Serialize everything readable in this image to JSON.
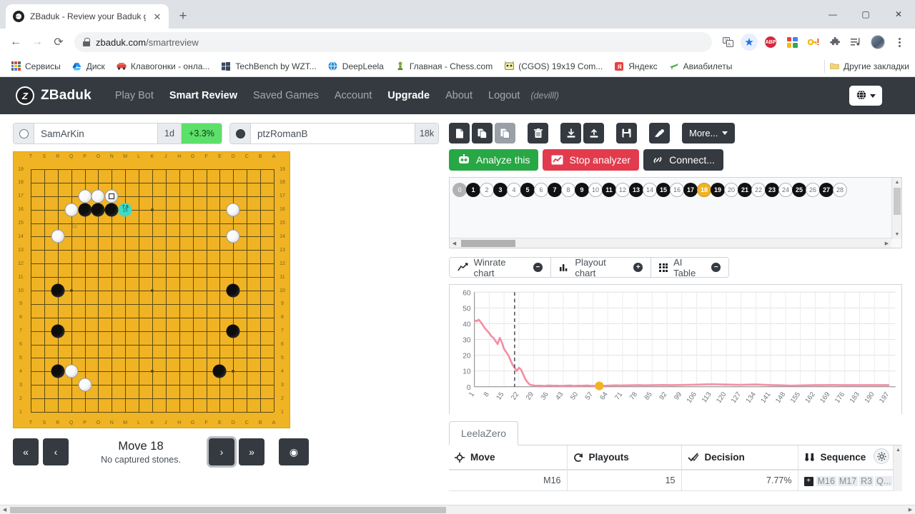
{
  "browser": {
    "tab": {
      "title": "ZBaduk - Review your Baduk gam",
      "favicon": "zbaduk-favicon",
      "close_label": "✕"
    },
    "newtab_label": "+",
    "window_controls": {
      "minimize": "—",
      "maximize": "▢",
      "close": "✕"
    },
    "nav": {
      "back": "←",
      "forward": "→",
      "reload": "⟳"
    },
    "omnibox": {
      "host": "zbaduk.com",
      "path": "/smartreview",
      "lock": "lock-icon"
    },
    "toolbar_icons": [
      {
        "name": "translate-icon",
        "glyph": "🗐"
      },
      {
        "name": "bookmark-star-icon",
        "glyph": "★"
      },
      {
        "name": "adblock-plus-icon",
        "glyph": "ABP"
      },
      {
        "name": "color-grid-icon",
        "glyph": ""
      },
      {
        "name": "password-key-icon",
        "glyph": "🔑"
      },
      {
        "name": "extensions-puzzle-icon",
        "glyph": "🧩"
      },
      {
        "name": "media-playlist-icon",
        "glyph": "≡♪"
      },
      {
        "name": "profile-avatar",
        "glyph": ""
      },
      {
        "name": "chrome-menu-icon",
        "glyph": "⋮"
      }
    ],
    "bookmarks": [
      {
        "label": "Сервисы",
        "icon": "apps-grid-icon"
      },
      {
        "label": "Диск",
        "icon": "drive-icon"
      },
      {
        "label": "Клавогонки - онла...",
        "icon": "car-icon"
      },
      {
        "label": "TechBench by WZT...",
        "icon": "windows-icon"
      },
      {
        "label": "DeepLeela",
        "icon": "globe-icon"
      },
      {
        "label": "Главная - Chess.com",
        "icon": "pawn-icon"
      },
      {
        "label": "(CGOS) 19x19 Com...",
        "icon": "cgos-icon"
      },
      {
        "label": "Яндекс",
        "icon": "yandex-icon"
      },
      {
        "label": "Авиабилеты",
        "icon": "plane-icon"
      }
    ],
    "other_bookmarks": {
      "label": "Другие закладки",
      "icon": "folder-icon"
    }
  },
  "site": {
    "brand": {
      "text": "ZBaduk",
      "logo_letter": "Z"
    },
    "nav_items": [
      {
        "label": "Play Bot",
        "state": "normal"
      },
      {
        "label": "Smart Review",
        "state": "active"
      },
      {
        "label": "Saved Games",
        "state": "normal"
      },
      {
        "label": "Account",
        "state": "normal"
      },
      {
        "label": "Upgrade",
        "state": "strong"
      },
      {
        "label": "About",
        "state": "normal"
      },
      {
        "label": "Logout",
        "state": "normal"
      }
    ],
    "user": "(devilll)",
    "language_button": {
      "icon": "globe-icon",
      "caret": "▾"
    }
  },
  "players": {
    "white": {
      "name": "SamArKin",
      "rank": "1d",
      "delta": "+3.3%",
      "stone": "white-stone",
      "delta_color": "#5ce06a"
    },
    "black": {
      "name": "ptzRomanB",
      "rank": "18k",
      "stone": "black-stone"
    }
  },
  "board": {
    "size": 19,
    "col_labels": [
      "T",
      "S",
      "R",
      "Q",
      "P",
      "O",
      "N",
      "M",
      "L",
      "K",
      "J",
      "H",
      "G",
      "F",
      "E",
      "D",
      "C",
      "B",
      "A"
    ],
    "row_labels": [
      "19",
      "18",
      "17",
      "16",
      "15",
      "14",
      "13",
      "12",
      "11",
      "10",
      "9",
      "8",
      "7",
      "6",
      "5",
      "4",
      "3",
      "2",
      "1"
    ],
    "stones": [
      {
        "col": 4,
        "row": 2,
        "color": "white"
      },
      {
        "col": 5,
        "row": 2,
        "color": "white"
      },
      {
        "col": 6,
        "row": 2,
        "color": "white",
        "last": true
      },
      {
        "col": 3,
        "row": 3,
        "color": "white"
      },
      {
        "col": 4,
        "row": 3,
        "color": "black"
      },
      {
        "col": 5,
        "row": 3,
        "color": "black"
      },
      {
        "col": 6,
        "row": 3,
        "color": "black"
      },
      {
        "col": 15,
        "row": 3,
        "color": "white"
      },
      {
        "col": 2,
        "row": 5,
        "color": "white"
      },
      {
        "col": 15,
        "row": 5,
        "color": "white"
      },
      {
        "col": 2,
        "row": 9,
        "color": "black"
      },
      {
        "col": 15,
        "row": 9,
        "color": "black"
      },
      {
        "col": 2,
        "row": 12,
        "color": "black"
      },
      {
        "col": 15,
        "row": 12,
        "color": "black"
      },
      {
        "col": 2,
        "row": 15,
        "color": "black"
      },
      {
        "col": 3,
        "row": 15,
        "color": "white"
      },
      {
        "col": 14,
        "row": 15,
        "color": "black"
      },
      {
        "col": 4,
        "row": 16,
        "color": "white"
      }
    ],
    "suggestion": {
      "col": 7,
      "row": 3,
      "top": "7.8",
      "bottom": "15",
      "color": "#3ddbc8"
    },
    "ghost": {
      "col": 3,
      "row": 4,
      "label": "14"
    }
  },
  "board_controls": {
    "first": "«",
    "prev": "‹",
    "next": "›",
    "last": "»",
    "eye": "◉",
    "move_title": "Move 18",
    "move_sub": "No captured stones."
  },
  "toolbar": {
    "buttons": [
      {
        "name": "new-file-button",
        "glyph": "🗋"
      },
      {
        "name": "copy-button",
        "glyph": "🗎"
      },
      {
        "name": "paste-button",
        "glyph": "🗐",
        "state": "lit"
      },
      {
        "name": "delete-button",
        "glyph": "🗑"
      },
      {
        "name": "download-button",
        "glyph": "⤓"
      },
      {
        "name": "upload-button",
        "glyph": "⤒"
      },
      {
        "name": "save-button",
        "glyph": "🖫"
      },
      {
        "name": "edit-button",
        "glyph": "✎"
      }
    ],
    "more_label": "More...",
    "more_caret": "▾"
  },
  "actions": {
    "analyze": {
      "label": "Analyze this",
      "icon": "robot-icon",
      "color": "#28a745"
    },
    "stop": {
      "label": "Stop analyzer",
      "icon": "chart-icon",
      "color": "#e23b4d"
    },
    "connect": {
      "label": "Connect...",
      "icon": "link-icon",
      "color": "#343a40"
    }
  },
  "move_list": {
    "moves": [
      {
        "n": "0",
        "type": "zero"
      },
      {
        "n": "1",
        "type": "b"
      },
      {
        "n": "2",
        "type": "w"
      },
      {
        "n": "3",
        "type": "b"
      },
      {
        "n": "4",
        "type": "w"
      },
      {
        "n": "5",
        "type": "b"
      },
      {
        "n": "6",
        "type": "w"
      },
      {
        "n": "7",
        "type": "b"
      },
      {
        "n": "8",
        "type": "w"
      },
      {
        "n": "9",
        "type": "b"
      },
      {
        "n": "10",
        "type": "w"
      },
      {
        "n": "11",
        "type": "b"
      },
      {
        "n": "12",
        "type": "w"
      },
      {
        "n": "13",
        "type": "b"
      },
      {
        "n": "14",
        "type": "w"
      },
      {
        "n": "15",
        "type": "b"
      },
      {
        "n": "16",
        "type": "w"
      },
      {
        "n": "17",
        "type": "b"
      },
      {
        "n": "18",
        "type": "cur"
      },
      {
        "n": "19",
        "type": "b"
      },
      {
        "n": "20",
        "type": "w"
      },
      {
        "n": "21",
        "type": "b"
      },
      {
        "n": "22",
        "type": "w"
      },
      {
        "n": "23",
        "type": "b"
      },
      {
        "n": "24",
        "type": "w"
      },
      {
        "n": "25",
        "type": "b"
      },
      {
        "n": "26",
        "type": "w"
      },
      {
        "n": "27",
        "type": "b"
      },
      {
        "n": "28",
        "type": "w"
      }
    ]
  },
  "chart_tabs": [
    {
      "label": "Winrate chart",
      "icon": "line-chart-icon",
      "toggle": "−"
    },
    {
      "label": "Playout chart",
      "icon": "bar-chart-icon",
      "toggle": "+"
    },
    {
      "label": "AI Table",
      "icon": "grid-icon",
      "toggle": "−"
    }
  ],
  "chart_data": {
    "type": "line",
    "title": "",
    "xlabel": "",
    "ylabel": "",
    "ylim": [
      0,
      60
    ],
    "yticks": [
      0,
      10,
      20,
      30,
      40,
      50,
      60
    ],
    "xlim": [
      1,
      200
    ],
    "xticks": [
      1,
      8,
      15,
      22,
      29,
      36,
      43,
      50,
      57,
      64,
      71,
      78,
      85,
      92,
      99,
      106,
      113,
      120,
      127,
      134,
      141,
      148,
      155,
      162,
      169,
      176,
      183,
      190,
      197
    ],
    "grid": true,
    "legend": "none",
    "line_color": "#f48fa4",
    "marker": {
      "x": 60,
      "y": 0.5,
      "color": "#f0b323",
      "label": "current move"
    },
    "cursor_line": {
      "x": 20,
      "style": "dashed",
      "color": "#333333"
    },
    "series": [
      {
        "name": "winrate delta",
        "x": [
          1,
          2,
          3,
          4,
          5,
          6,
          7,
          8,
          9,
          10,
          11,
          12,
          13,
          14,
          15,
          16,
          17,
          18,
          19,
          20,
          21,
          22,
          23,
          24,
          25,
          26,
          27,
          28,
          29,
          30,
          32,
          34,
          36,
          38,
          40,
          42,
          44,
          46,
          48,
          50,
          52,
          54,
          56,
          58,
          60,
          62,
          64,
          66,
          68,
          70,
          74,
          78,
          82,
          86,
          90,
          94,
          98,
          102,
          106,
          110,
          114,
          118,
          122,
          126,
          130,
          134,
          138,
          142,
          146,
          150,
          154,
          158,
          162,
          166,
          170,
          174,
          178,
          182,
          186,
          190,
          194,
          197
        ],
        "values": [
          42,
          41.5,
          42.5,
          41,
          39,
          37,
          35.5,
          34,
          32,
          31,
          29,
          27,
          31,
          28,
          24,
          22,
          20,
          17,
          14,
          12,
          10,
          12,
          11,
          8,
          5,
          3,
          1.5,
          1,
          0.8,
          0.6,
          0.7,
          0.5,
          0.8,
          0.6,
          0.7,
          0.5,
          0.6,
          0.8,
          0.5,
          0.7,
          0.6,
          0.8,
          0.6,
          0.5,
          0.5,
          0.6,
          0.7,
          0.8,
          0.9,
          0.8,
          0.9,
          1.0,
          0.9,
          1.0,
          1.1,
          1.0,
          1.1,
          1.2,
          1.3,
          1.5,
          1.6,
          1.4,
          1.3,
          1.2,
          1.3,
          1.4,
          1.2,
          1.0,
          0.9,
          0.7,
          0.8,
          0.9,
          1.0,
          1.0,
          1.1,
          1.0,
          1.0,
          1.0,
          1.0,
          1.0,
          1.0,
          1.0
        ]
      }
    ]
  },
  "ai_panel": {
    "tab": "LeelaZero",
    "gear_icon": "gear-icon",
    "columns": [
      {
        "label": "Move",
        "icon": "target-icon"
      },
      {
        "label": "Playouts",
        "icon": "refresh-icon"
      },
      {
        "label": "Decision",
        "icon": "check-icon"
      },
      {
        "label": "Sequence",
        "icon": "binocular-icon"
      }
    ],
    "rows": [
      {
        "move": "M16",
        "playouts": "15",
        "decision": "7.77%",
        "sequence": "M16 M17 R3 Q..."
      }
    ]
  }
}
